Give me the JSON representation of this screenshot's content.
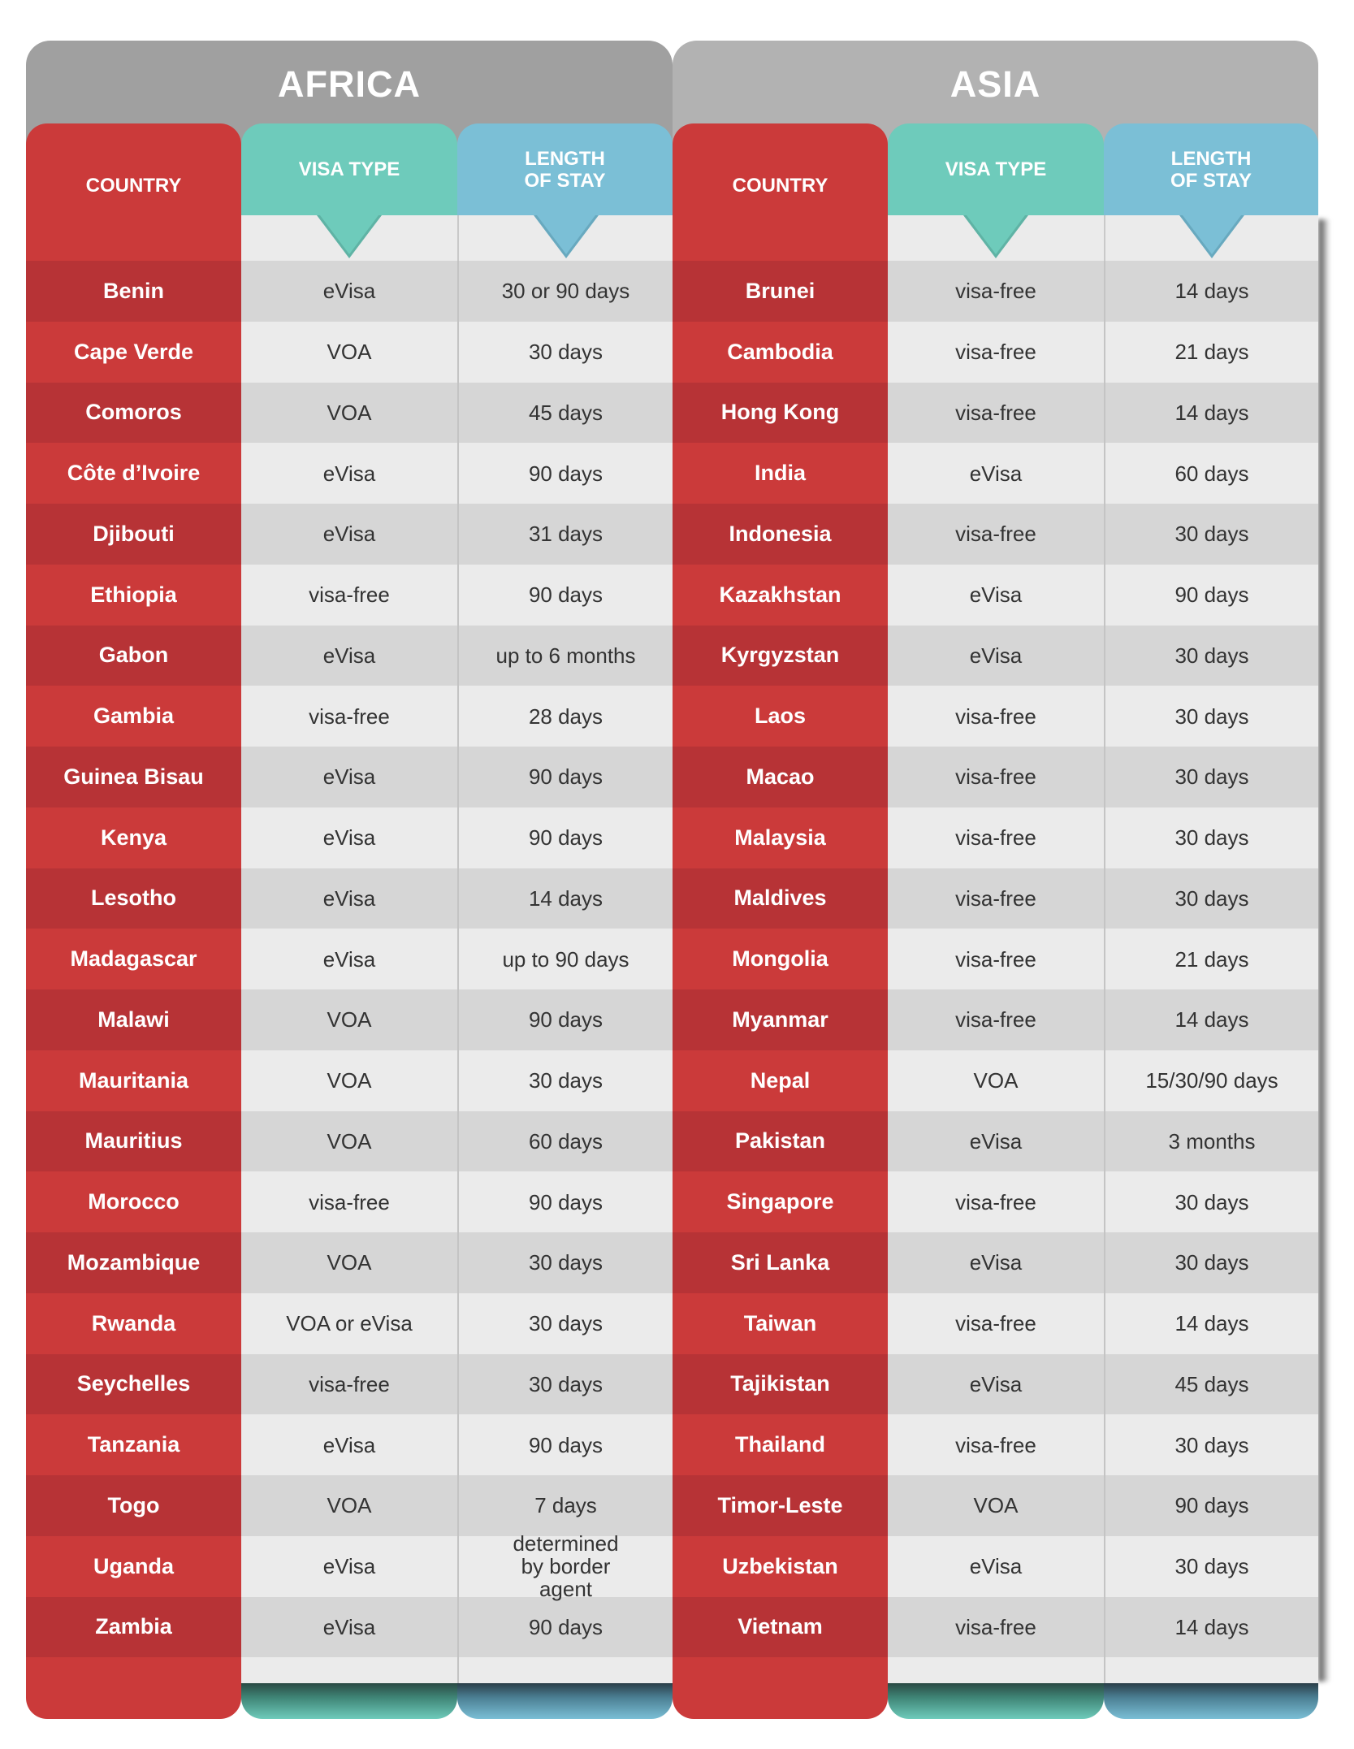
{
  "regions": [
    {
      "title": "AFRICA",
      "headers": {
        "country": "COUNTRY",
        "visa_type": "VISA TYPE",
        "length_line1": "LENGTH",
        "length_line2": "OF STAY"
      },
      "rows": [
        {
          "country": "Benin",
          "visa": "eVisa",
          "stay": "30 or 90 days"
        },
        {
          "country": "Cape Verde",
          "visa": "VOA",
          "stay": "30 days"
        },
        {
          "country": "Comoros",
          "visa": "VOA",
          "stay": "45 days"
        },
        {
          "country": "Côte d’Ivoire",
          "visa": "eVisa",
          "stay": "90 days"
        },
        {
          "country": "Djibouti",
          "visa": "eVisa",
          "stay": "31 days"
        },
        {
          "country": "Ethiopia",
          "visa": "visa-free",
          "stay": "90 days"
        },
        {
          "country": "Gabon",
          "visa": "eVisa",
          "stay": "up to 6 months"
        },
        {
          "country": "Gambia",
          "visa": "visa-free",
          "stay": "28 days"
        },
        {
          "country": "Guinea Bisau",
          "visa": "eVisa",
          "stay": "90 days"
        },
        {
          "country": "Kenya",
          "visa": "eVisa",
          "stay": "90 days"
        },
        {
          "country": "Lesotho",
          "visa": "eVisa",
          "stay": "14 days"
        },
        {
          "country": "Madagascar",
          "visa": "eVisa",
          "stay": "up to 90 days"
        },
        {
          "country": "Malawi",
          "visa": "VOA",
          "stay": "90 days"
        },
        {
          "country": "Mauritania",
          "visa": "VOA",
          "stay": "30 days"
        },
        {
          "country": "Mauritius",
          "visa": "VOA",
          "stay": "60 days"
        },
        {
          "country": "Morocco",
          "visa": "visa-free",
          "stay": "90 days"
        },
        {
          "country": "Mozambique",
          "visa": "VOA",
          "stay": "30 days"
        },
        {
          "country": "Rwanda",
          "visa": "VOA or eVisa",
          "stay": "30 days"
        },
        {
          "country": "Seychelles",
          "visa": "visa-free",
          "stay": "30 days"
        },
        {
          "country": "Tanzania",
          "visa": "eVisa",
          "stay": "90 days"
        },
        {
          "country": "Togo",
          "visa": "VOA",
          "stay": "7 days"
        },
        {
          "country": "Uganda",
          "visa": "eVisa",
          "stay": "determined by border agent"
        },
        {
          "country": "Zambia",
          "visa": "eVisa",
          "stay": "90 days"
        }
      ]
    },
    {
      "title": "ASIA",
      "headers": {
        "country": "COUNTRY",
        "visa_type": "VISA TYPE",
        "length_line1": "LENGTH",
        "length_line2": "OF STAY"
      },
      "rows": [
        {
          "country": "Brunei",
          "visa": "visa-free",
          "stay": "14 days"
        },
        {
          "country": "Cambodia",
          "visa": "visa-free",
          "stay": "21 days"
        },
        {
          "country": "Hong Kong",
          "visa": "visa-free",
          "stay": "14 days"
        },
        {
          "country": "India",
          "visa": "eVisa",
          "stay": "60 days"
        },
        {
          "country": "Indonesia",
          "visa": "visa-free",
          "stay": "30 days"
        },
        {
          "country": "Kazakhstan",
          "visa": "eVisa",
          "stay": "90 days"
        },
        {
          "country": "Kyrgyzstan",
          "visa": "eVisa",
          "stay": "30 days"
        },
        {
          "country": "Laos",
          "visa": "visa-free",
          "stay": "30 days"
        },
        {
          "country": "Macao",
          "visa": "visa-free",
          "stay": "30 days"
        },
        {
          "country": "Malaysia",
          "visa": "visa-free",
          "stay": "30 days"
        },
        {
          "country": "Maldives",
          "visa": "visa-free",
          "stay": "30 days"
        },
        {
          "country": "Mongolia",
          "visa": "visa-free",
          "stay": "21 days"
        },
        {
          "country": "Myanmar",
          "visa": "visa-free",
          "stay": "14 days"
        },
        {
          "country": "Nepal",
          "visa": "VOA",
          "stay": "15/30/90 days"
        },
        {
          "country": "Pakistan",
          "visa": "eVisa",
          "stay": "3 months"
        },
        {
          "country": "Singapore",
          "visa": "visa-free",
          "stay": "30 days"
        },
        {
          "country": "Sri Lanka",
          "visa": "eVisa",
          "stay": "30 days"
        },
        {
          "country": "Taiwan",
          "visa": "visa-free",
          "stay": "14 days"
        },
        {
          "country": "Tajikistan",
          "visa": "eVisa",
          "stay": "45 days"
        },
        {
          "country": "Thailand",
          "visa": "visa-free",
          "stay": "30 days"
        },
        {
          "country": "Timor-Leste",
          "visa": "VOA",
          "stay": "90 days"
        },
        {
          "country": "Uzbekistan",
          "visa": "eVisa",
          "stay": "30 days"
        },
        {
          "country": "Vietnam",
          "visa": "visa-free",
          "stay": "14 days"
        }
      ]
    }
  ],
  "colors": {
    "country_red": "#cb3a3a",
    "country_red_dark": "#b73336",
    "visa_teal": "#6ecbbb",
    "stay_blue": "#7bbfd6",
    "africa_gray": "#a0a0a0",
    "asia_gray": "#b2b2b2",
    "row_light": "#ebebeb",
    "row_dark": "#d6d6d6"
  }
}
